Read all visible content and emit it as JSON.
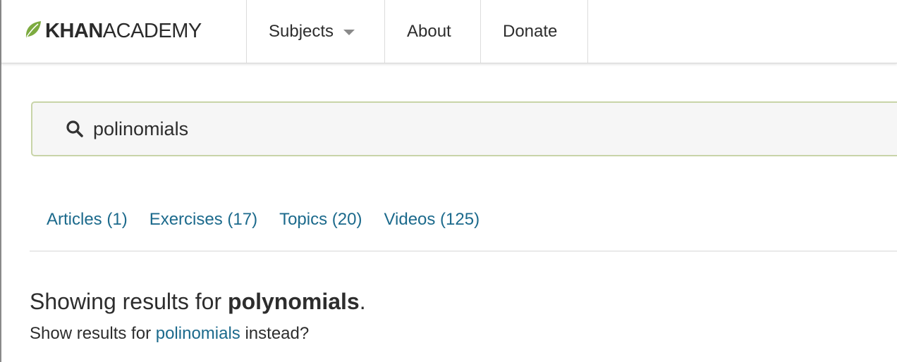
{
  "header": {
    "logo": {
      "part1": "KHAN",
      "part2": "ACADEMY",
      "leaf_color": "#7dab40"
    },
    "nav": {
      "subjects": "Subjects",
      "about": "About",
      "donate": "Donate"
    }
  },
  "search": {
    "value": "polinomials",
    "icon": "search-icon"
  },
  "tabs": [
    {
      "label": "Articles (1)"
    },
    {
      "label": "Exercises (17)"
    },
    {
      "label": "Topics (20)"
    },
    {
      "label": "Videos (125)"
    }
  ],
  "results": {
    "prefix": "Showing results for ",
    "corrected_term": "polynomials",
    "suffix": ".",
    "alt_prefix": "Show results for ",
    "alt_term": "polinomials",
    "alt_suffix": " instead?"
  },
  "colors": {
    "link": "#1c6a8c",
    "search_border": "#c8d4a8"
  }
}
